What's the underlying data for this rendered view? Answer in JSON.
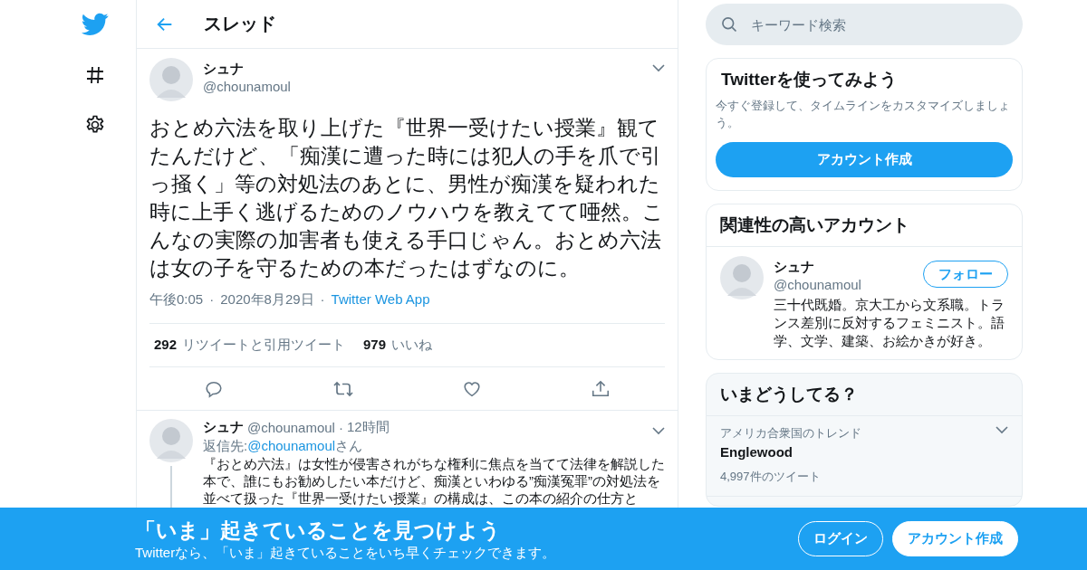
{
  "header": {
    "title": "スレッド"
  },
  "tweet": {
    "name": "シュナ",
    "handle": "@chounamoul",
    "text": "おとめ六法を取り上げた『世界一受けたい授業』観てたんだけど、「痴漢に遭った時には犯人の手を爪で引っ掻く」等の対処法のあとに、男性が痴漢を疑われた時に上手く逃げるためのノウハウを教えてて唖然。こんなの実際の加害者も使える手口じゃん。おとめ六法は女の子を守るための本だったはずなのに。",
    "time": "午後0:05",
    "separator": "·",
    "date": "2020年8月29日",
    "source": "Twitter Web App",
    "stats": [
      {
        "count": "292",
        "label": "リツイートと引用ツイート"
      },
      {
        "count": "979",
        "label": "いいね"
      }
    ]
  },
  "reply": {
    "name": "シュナ",
    "handle": "@chounamoul",
    "separator": "·",
    "time": "12時間",
    "reply_prefix": "返信先: ",
    "reply_to": "@chounamoul",
    "reply_suffix": "さん",
    "text": "『おとめ六法』は女性が侵害されがちな権利に焦点を当てて法律を解説した本で、誰にもお勧めしたい本だけど、痴漢といわゆる”痴漢冤罪”の対処法を並べて扱った『世界一受けたい授業』の構成は、この本の紹介の仕方と"
  },
  "search": {
    "placeholder": "キーワード検索"
  },
  "signup_card": {
    "title": "Twitterを使ってみよう",
    "text": "今すぐ登録して、タイムラインをカスタマイズしましょう。",
    "button": "アカウント作成"
  },
  "related": {
    "title": "関連性の高いアカウント",
    "accounts": [
      {
        "name": "シュナ",
        "handle": "@chounamoul",
        "bio": "三十代既婚。京大工から文系職。トランス差別に反対するフェミニスト。語学、文学、建築、お絵かきが好き。",
        "button": "フォロー"
      }
    ]
  },
  "trends": {
    "title": "いまどうしてる？",
    "items": [
      {
        "context": "アメリカ合衆国のトレンド",
        "name": "Englewood",
        "count": "4,997件のツイート"
      }
    ]
  },
  "banner": {
    "headline": "「いま」起きていることを見つけよう",
    "text": "Twitterなら、「いま」起きていることをいち早くチェックできます。",
    "buttons": [
      {
        "label": "ログイン",
        "kind": "outline"
      },
      {
        "label": "アカウント作成",
        "kind": "filled"
      }
    ]
  }
}
